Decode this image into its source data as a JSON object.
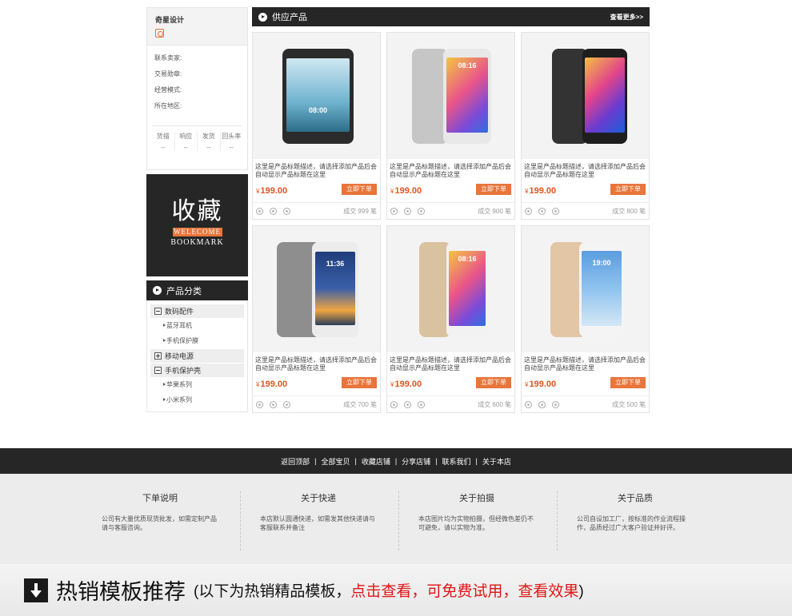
{
  "shop": {
    "name": "奇星设计",
    "info": [
      "联系卖家:",
      "交易勋章:",
      "经营模式:",
      "所在地区:"
    ],
    "stats": [
      {
        "label": "货描",
        "value": "--"
      },
      {
        "label": "响应",
        "value": "--"
      },
      {
        "label": "发货",
        "value": "--"
      },
      {
        "label": "回头率",
        "value": "--"
      }
    ]
  },
  "favorite": {
    "title": "收藏",
    "welcome": "WELECOME",
    "bookmark": "BOOKMARK"
  },
  "categories": {
    "title": "产品分类",
    "groups": [
      {
        "label": "数码配件",
        "subs": [
          "蓝牙耳机",
          "手机保护膜"
        ]
      },
      {
        "label": "移动电源",
        "subs": []
      },
      {
        "label": "手机保护壳",
        "subs": [
          "苹果系列",
          "小米系列"
        ]
      }
    ]
  },
  "products": {
    "title": "供应产品",
    "more": "查看更多>>",
    "currency": "¥",
    "buy_label": "立即下单",
    "items": [
      {
        "desc": "这里是产品标题描述，请选择添加产品后会自动显示产品标题在这里",
        "price": "199.00",
        "sold": "成交 999 笔"
      },
      {
        "desc": "这里是产品标题描述，请选择添加产品后会自动显示产品标题在这里",
        "price": "199.00",
        "sold": "成交 900 笔"
      },
      {
        "desc": "这里是产品标题描述，请选择添加产品后会自动显示产品标题在这里",
        "price": "199.00",
        "sold": "成交 800 笔"
      },
      {
        "desc": "这里是产品标题描述，请选择添加产品后会自动显示产品标题在这里",
        "price": "199.00",
        "sold": "成交 700 笔"
      },
      {
        "desc": "这里是产品标题描述，请选择添加产品后会自动显示产品标题在这里",
        "price": "199.00",
        "sold": "成交 600 笔"
      },
      {
        "desc": "这里是产品标题描述，请选择添加产品后会自动显示产品标题在这里",
        "price": "199.00",
        "sold": "成交 500 笔"
      }
    ],
    "clocks": [
      "08:00",
      "08:16",
      "",
      "11:36",
      "08:16",
      "19:00"
    ]
  },
  "footer_nav": [
    "返回顶部",
    "全部宝贝",
    "收藏店铺",
    "分享店铺",
    "联系我们",
    "关于本店"
  ],
  "footer_info": [
    {
      "title": "下单说明",
      "text": "公司有大量优质现货批发，如需定制产品请与客服咨询。"
    },
    {
      "title": "关于快递",
      "text": "本店默认圆通快递，如需发其他快递请与客服联系并备注"
    },
    {
      "title": "关于拍摄",
      "text": "本店图片均为实物拍摄，但经微色差仍不可避免，请以实物为准。"
    },
    {
      "title": "关于品质",
      "text": "公司自设加工厂，按标准的作业流程操作，品质经过广大客户验证并好评。"
    }
  ],
  "banner": {
    "main": "热销模板推荐",
    "sub_prefix": "(以下为热销精品模板，",
    "sub_red": "点击查看，可免费试用，查看效果",
    "sub_suffix": ")"
  }
}
